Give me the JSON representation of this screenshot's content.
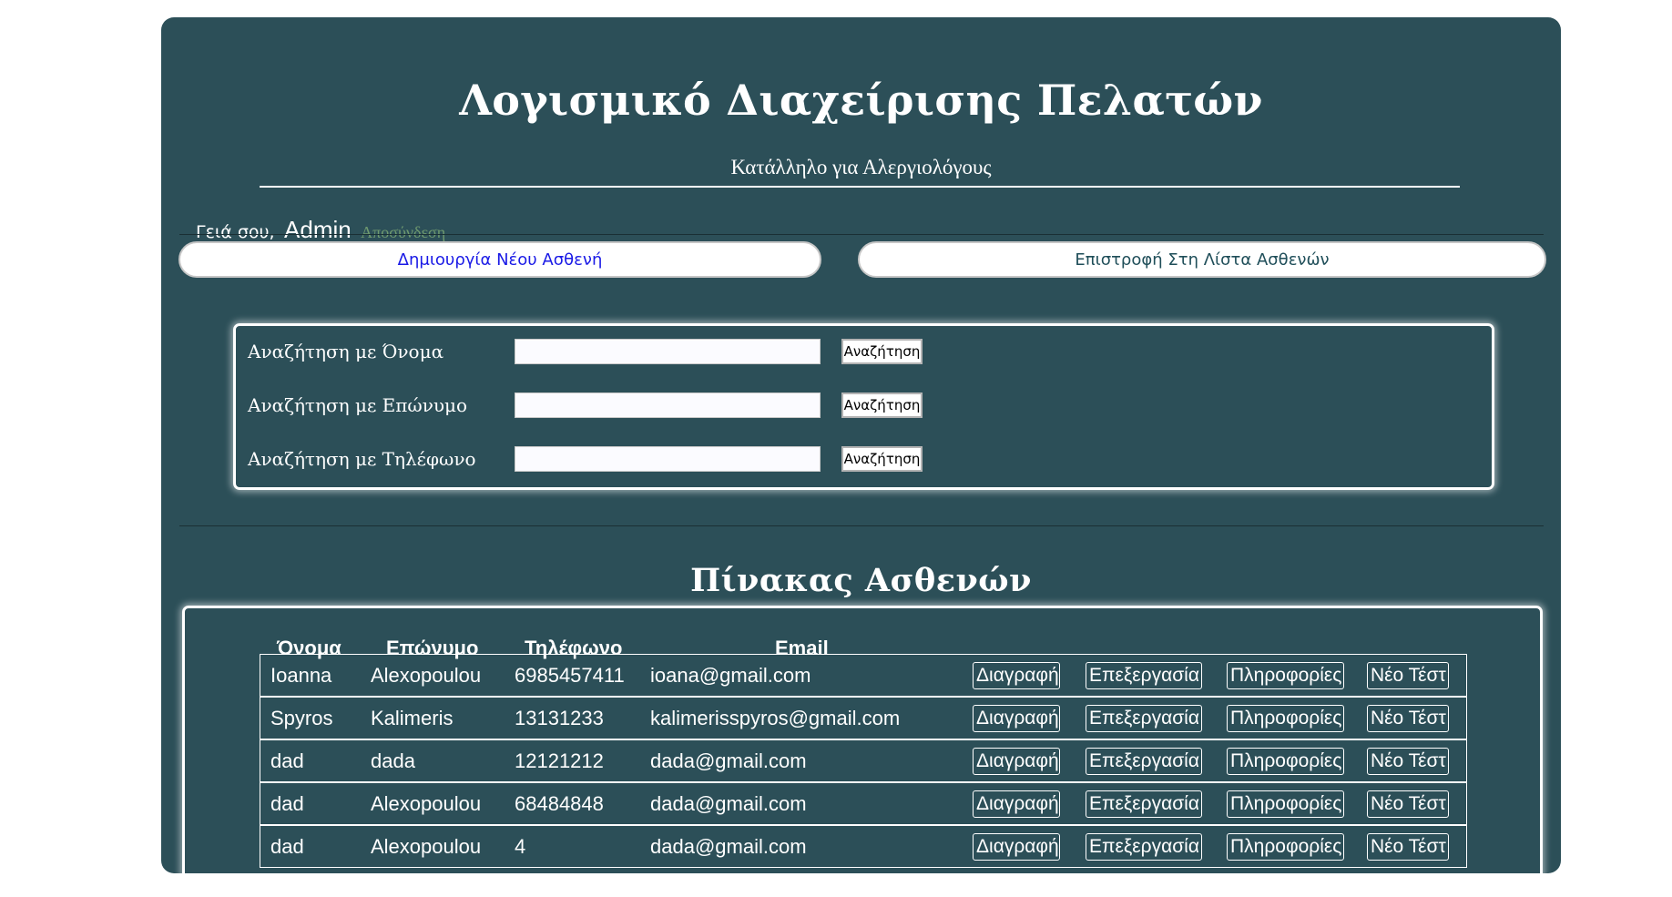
{
  "header": {
    "title": "Λογισμικό Διαχείρισης Πελατών",
    "subtitle": "Κατάλληλο για Αλεργιολόγους"
  },
  "user_bar": {
    "greeting": "Γειά σου,",
    "username": "Admin",
    "logout_label": "Αποσύνδεση"
  },
  "nav": {
    "new_patient_label": "Δημιουργία Νέου Ασθενή",
    "back_to_list_label": "Επιστροφή Στη Λίστα Ασθενών"
  },
  "search": {
    "rows": [
      {
        "label": "Αναζήτηση με Όνομα",
        "value": "",
        "button_label": "Αναζήτηση"
      },
      {
        "label": "Αναζήτηση με Επώνυμο",
        "value": "",
        "button_label": "Αναζήτηση"
      },
      {
        "label": "Αναζήτηση με Τηλέφωνο",
        "value": "",
        "button_label": "Αναζήτηση"
      }
    ]
  },
  "patients": {
    "title": "Πίνακας Ασθενών",
    "columns": [
      "Όνομα",
      "Επώνυμο",
      "Τηλέφωνο",
      "Email"
    ],
    "action_labels": {
      "delete": "Διαγραφή",
      "edit": "Επεξεργασία",
      "info": "Πληροφορίες",
      "new_test": "Νέο Τέστ"
    },
    "rows": [
      {
        "first": "Ioanna",
        "last": "Alexopoulou",
        "phone": "6985457411",
        "email": "ioana@gmail.com"
      },
      {
        "first": "Spyros",
        "last": "Kalimeris",
        "phone": "13131233",
        "email": "kalimerisspyros@gmail.com"
      },
      {
        "first": "dad",
        "last": "dada",
        "phone": "12121212",
        "email": "dada@gmail.com"
      },
      {
        "first": "dad",
        "last": "Alexopoulou",
        "phone": "68484848",
        "email": "dada@gmail.com"
      },
      {
        "first": "dad",
        "last": "Alexopoulou",
        "phone": "4",
        "email": "dada@gmail.com"
      }
    ]
  },
  "colors": {
    "panel_bg": "#2c4f58",
    "logout_link": "#6f9a6f",
    "new_patient_link": "#1a1ae6"
  }
}
